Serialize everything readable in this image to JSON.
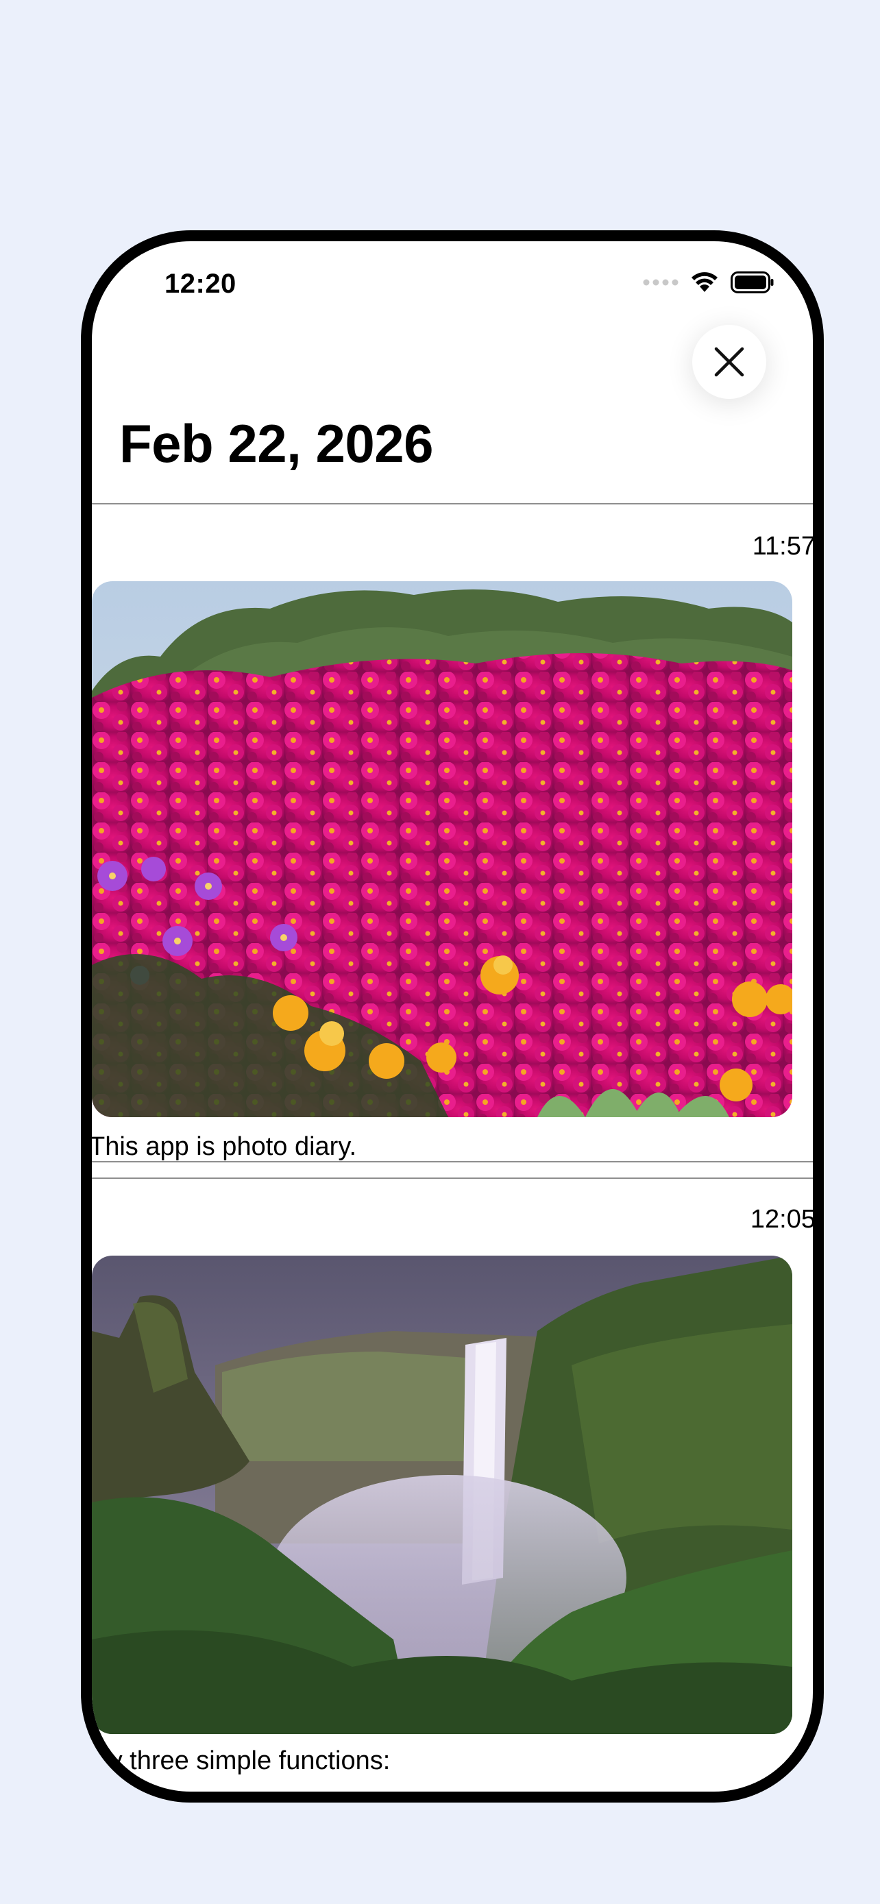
{
  "status_bar": {
    "time": "12:20"
  },
  "header": {
    "date_title": "Feb 22, 2026",
    "close_icon": "close-icon"
  },
  "entries": [
    {
      "time": "11:57",
      "photo": "pink-ice-plant-flowers-photo",
      "caption": "This app is photo diary."
    },
    {
      "time": "12:05",
      "photo": "waterfall-landscape-photo",
      "caption": "nly three simple functions:"
    }
  ],
  "colors": {
    "background": "#ebf0fb",
    "frame": "#000000",
    "screen": "#ffffff"
  }
}
